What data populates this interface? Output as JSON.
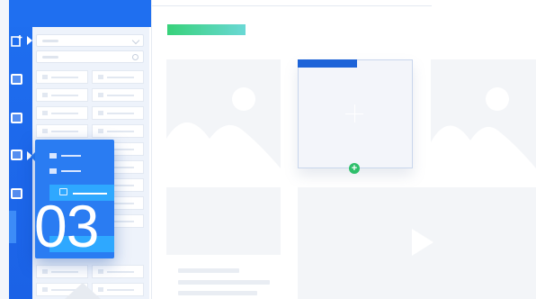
{
  "overlay": {
    "step_number": "03"
  },
  "icons": {
    "rail": [
      "add-page-icon",
      "page-icon",
      "page-icon",
      "page-icon",
      "page-icon"
    ],
    "content": [
      "image-placeholder-icon",
      "plus-icon",
      "add-icon",
      "play-icon"
    ]
  },
  "colors": {
    "brand_blue": "#1f6ff0",
    "card_blue": "#2a7cf2",
    "selection_blue": "#2ea8ff",
    "accent_green": "#37d27a",
    "add_green": "#2fbf6b",
    "placeholder_gray": "#f3f5f8"
  }
}
